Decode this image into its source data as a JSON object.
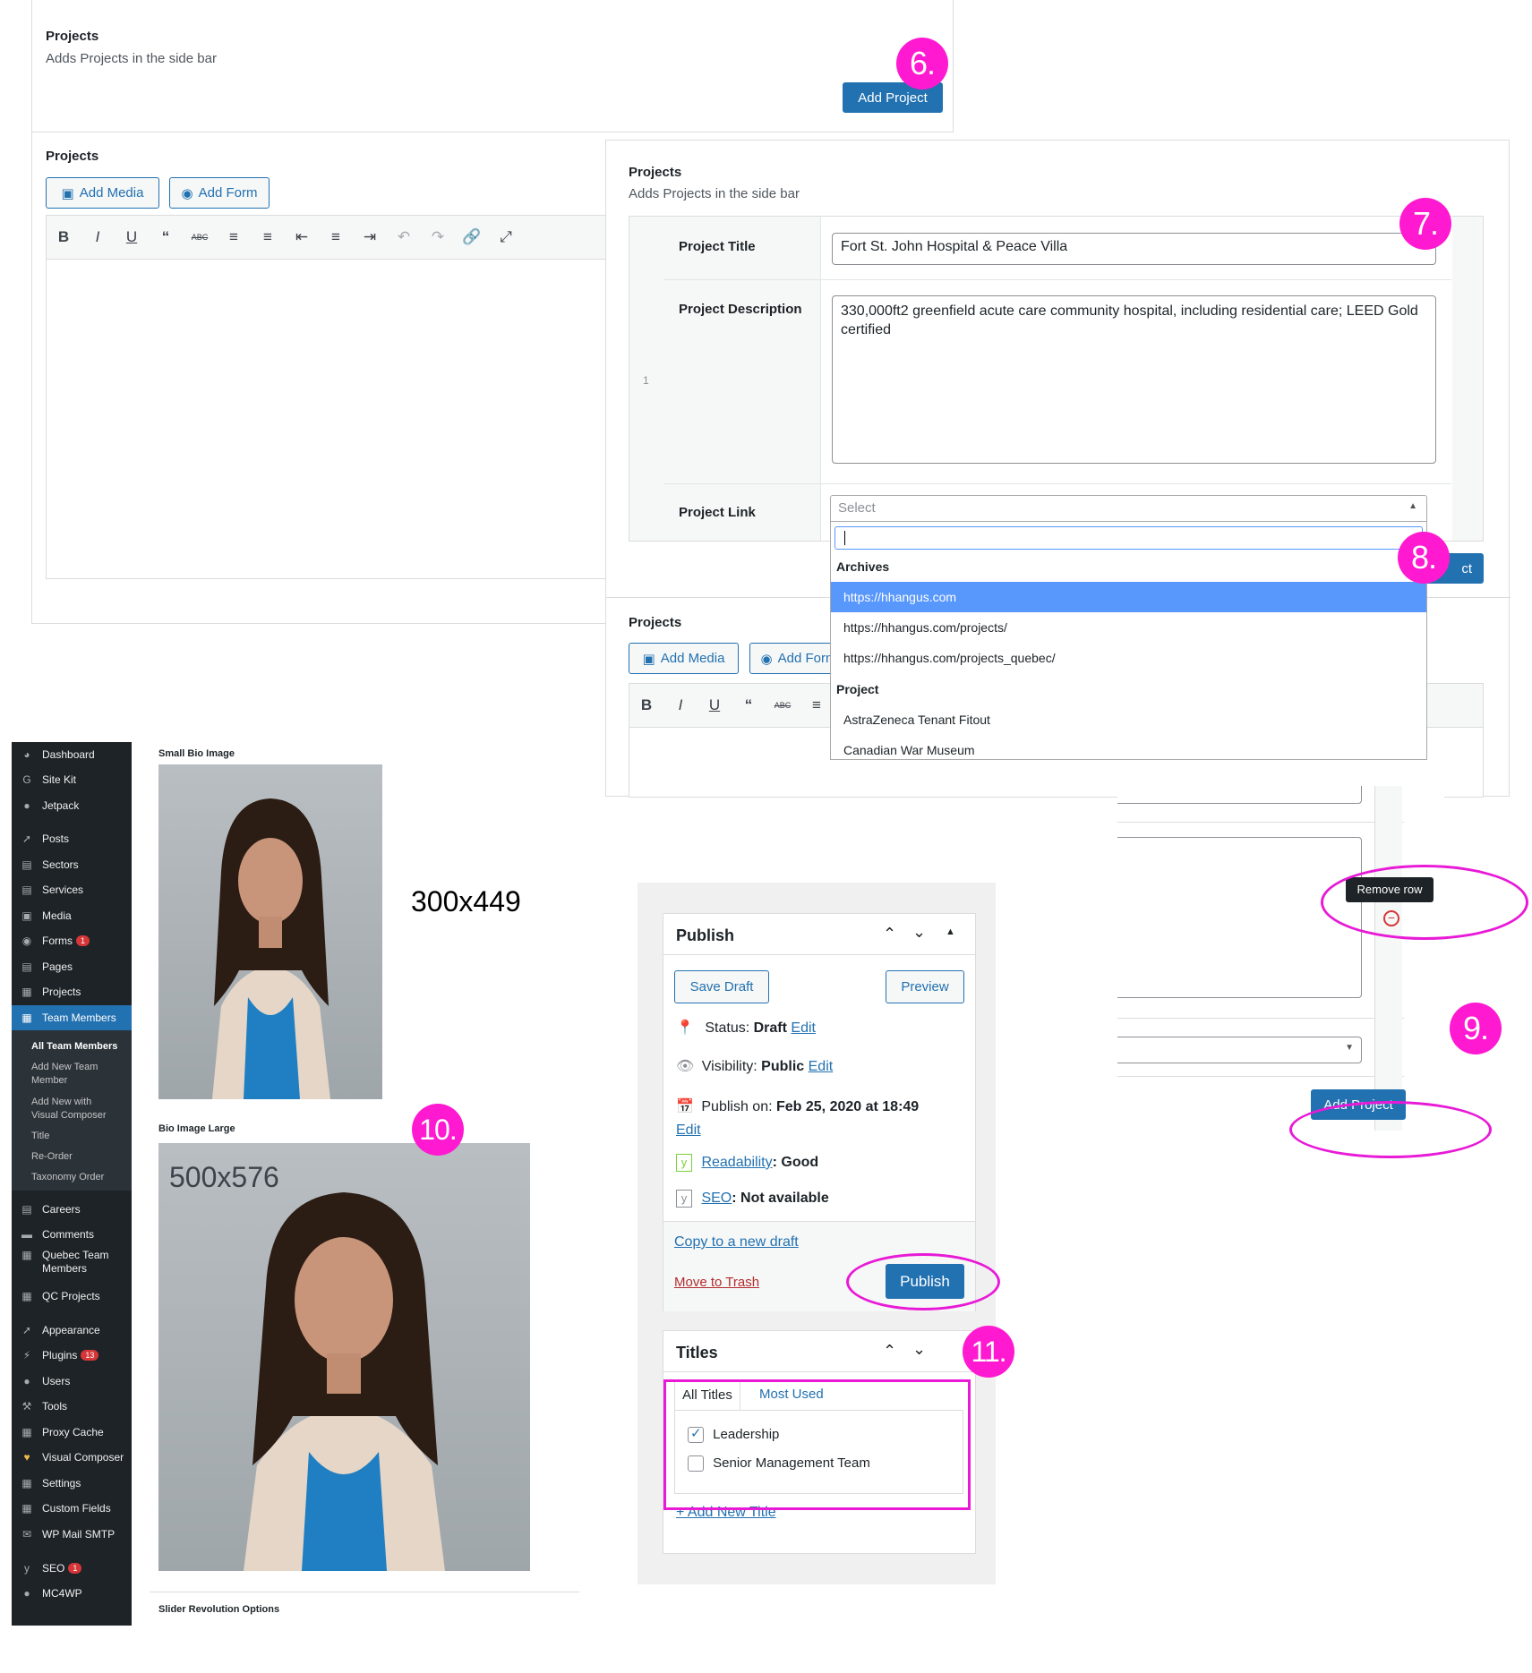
{
  "top_panel": {
    "title": "Projects",
    "description": "Adds Projects in the side bar",
    "add_project_label": "Add Project",
    "step": "6."
  },
  "editor_panel": {
    "title": "Projects",
    "add_media_label": "Add Media",
    "add_form_label": "Add Form"
  },
  "repeater_panel": {
    "title": "Projects",
    "description": "Adds Projects in the side bar",
    "row_number": "1",
    "project_title_label": "Project Title",
    "project_title_value": "Fort St. John Hospital & Peace Villa",
    "project_description_label": "Project Description",
    "project_description_value": "330,000ft2 greenfield acute care community hospital, including residential care; LEED Gold certified",
    "project_link_label": "Project Link",
    "select_placeholder": "Select",
    "step7": "7.",
    "step8": "8.",
    "partial_button_text": "ct",
    "dropdown": {
      "group1": "Archives",
      "items1": [
        "https://hhangus.com",
        "https://hhangus.com/projects/",
        "https://hhangus.com/projects_quebec/"
      ],
      "group2": "Project",
      "items2": [
        "AstraZeneca Tenant Fitout",
        "Canadian War Museum"
      ]
    },
    "second_title": "Projects",
    "add_media_label": "Add Media",
    "add_form_label": "Add Form"
  },
  "sidebar": {
    "items": [
      {
        "icon": "dashboard-icon",
        "label": "Dashboard"
      },
      {
        "icon": "site-kit-icon",
        "label": "Site Kit"
      },
      {
        "icon": "jetpack-icon",
        "label": "Jetpack"
      },
      {
        "icon": "pin-icon",
        "label": "Posts"
      },
      {
        "icon": "page-icon",
        "label": "Sectors"
      },
      {
        "icon": "page-icon",
        "label": "Services"
      },
      {
        "icon": "media-icon",
        "label": "Media"
      },
      {
        "icon": "forms-icon",
        "label": "Forms",
        "badge": "1"
      },
      {
        "icon": "pages-icon",
        "label": "Pages"
      },
      {
        "icon": "projects-icon",
        "label": "Projects"
      },
      {
        "icon": "team-icon",
        "label": "Team Members"
      }
    ],
    "submenu": [
      "All Team Members",
      "Add New Team Member",
      "Add New with Visual Composer",
      "Title",
      "Re-Order",
      "Taxonomy Order"
    ],
    "items2": [
      {
        "icon": "careers-icon",
        "label": "Careers"
      },
      {
        "icon": "comments-icon",
        "label": "Comments"
      },
      {
        "icon": "team-icon",
        "label": "Quebec Team Members"
      },
      {
        "icon": "projects-icon",
        "label": "QC Projects"
      },
      {
        "icon": "appearance-icon",
        "label": "Appearance"
      },
      {
        "icon": "plugins-icon",
        "label": "Plugins",
        "badge": "13"
      },
      {
        "icon": "users-icon",
        "label": "Users"
      },
      {
        "icon": "tools-icon",
        "label": "Tools"
      },
      {
        "icon": "cache-icon",
        "label": "Proxy Cache"
      },
      {
        "icon": "vc-icon",
        "label": "Visual Composer"
      },
      {
        "icon": "settings-icon",
        "label": "Settings"
      },
      {
        "icon": "fields-icon",
        "label": "Custom Fields"
      },
      {
        "icon": "mail-icon",
        "label": "WP Mail SMTP"
      },
      {
        "icon": "seo-icon",
        "label": "SEO",
        "badge": "1"
      },
      {
        "icon": "mc4wp-icon",
        "label": "MC4WP"
      }
    ]
  },
  "bio": {
    "small_label": "Small Bio Image",
    "small_size": "300x449",
    "large_label": "Bio Image Large",
    "large_size": "500x576",
    "step10": "10.",
    "slider_label": "Slider Revolution Options"
  },
  "publish_box": {
    "title": "Publish",
    "save_draft": "Save Draft",
    "preview": "Preview",
    "status_label": "Status: ",
    "status_value": "Draft",
    "visibility_label": "Visibility: ",
    "visibility_value": "Public",
    "edit": "Edit",
    "publish_on_label": "Publish on: ",
    "publish_on_value": "Feb 25, 2020 at 18:49",
    "readability_link": "Readability",
    "readability_value": ": Good",
    "seo_link": "SEO",
    "seo_value": ": Not available",
    "copy_draft": "Copy to a new draft",
    "move_trash": "Move to Trash",
    "publish_btn": "Publish"
  },
  "titles_box": {
    "title": "Titles",
    "tab_all": "All Titles",
    "tab_most": "Most Used",
    "items": [
      {
        "label": "Leadership",
        "checked": true
      },
      {
        "label": "Senior Management Team",
        "checked": false
      }
    ],
    "add_new": "+ Add New Title",
    "step11": "11."
  },
  "right_fragment": {
    "tooltip": "Remove row",
    "add_project_label": "Add Project",
    "step9": "9."
  },
  "colors": {
    "wp_blue": "#2271b1",
    "annotation_magenta": "#ff19d1",
    "admin_sidebar": "#1d2327",
    "dropdown_highlight": "#5897fb"
  }
}
